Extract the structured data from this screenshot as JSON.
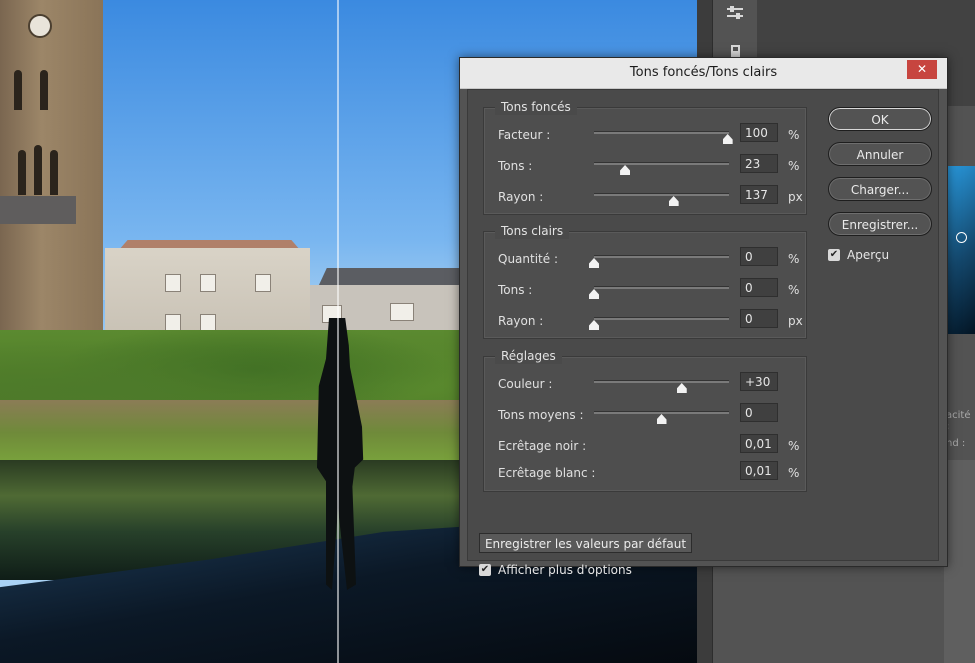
{
  "dialog": {
    "title": "Tons foncés/Tons clairs",
    "close_glyph": "✕",
    "groups": {
      "shadows": {
        "title": "Tons foncés",
        "rows": [
          {
            "label": "Facteur :",
            "value": "100",
            "unit": "%",
            "slider_pct": 99
          },
          {
            "label": "Tons :",
            "value": "23",
            "unit": "%",
            "slider_pct": 23
          },
          {
            "label": "Rayon :",
            "value": "137",
            "unit": "px",
            "slider_pct": 59
          }
        ]
      },
      "highlights": {
        "title": "Tons clairs",
        "rows": [
          {
            "label": "Quantité :",
            "value": "0",
            "unit": "%",
            "slider_pct": 0
          },
          {
            "label": "Tons :",
            "value": "0",
            "unit": "%",
            "slider_pct": 0
          },
          {
            "label": "Rayon :",
            "value": "0",
            "unit": "px",
            "slider_pct": 0
          }
        ]
      },
      "adjustments": {
        "title": "Réglages",
        "rows": [
          {
            "label": "Couleur :",
            "value": "+30",
            "unit": "",
            "slider_pct": 65
          },
          {
            "label": "Tons moyens :",
            "value": "0",
            "unit": "",
            "slider_pct": 50
          },
          {
            "label": "Ecrêtage noir :",
            "value": "0,01",
            "unit": "%"
          },
          {
            "label": "Ecrêtage blanc :",
            "value": "0,01",
            "unit": "%"
          }
        ]
      }
    },
    "buttons": {
      "ok": "OK",
      "cancel": "Annuler",
      "load": "Charger...",
      "save": "Enregistrer..."
    },
    "preview": {
      "label": "Aperçu",
      "checked": true
    },
    "save_defaults": "Enregistrer les valeurs par défaut",
    "more_options": {
      "label": "Afficher plus d'options",
      "checked": true
    }
  },
  "side_panel": {
    "label_opacity": "acité :",
    "label_fill": "nd :"
  },
  "icons": {
    "adjust": "sliders-icon",
    "check": "checkmark-icon"
  }
}
